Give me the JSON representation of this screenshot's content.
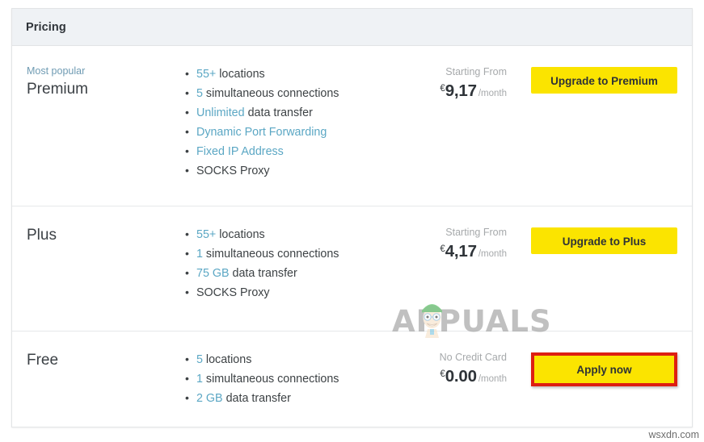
{
  "card": {
    "header_title": "Pricing"
  },
  "plans": [
    {
      "badge": "Most popular",
      "name": "Premium",
      "features": [
        {
          "highlight": "55+",
          "rest": " locations"
        },
        {
          "highlight": "5",
          "rest": " simultaneous connections"
        },
        {
          "highlight": "Unlimited",
          "rest": " data transfer"
        },
        {
          "highlight": "Dynamic Port Forwarding",
          "rest": ""
        },
        {
          "highlight": "Fixed IP Address",
          "rest": ""
        },
        {
          "highlight": "",
          "rest": "SOCKS Proxy"
        }
      ],
      "price_caption": "Starting From",
      "currency": "€",
      "price": "9,17",
      "period": "/month",
      "button_label": "Upgrade to Premium",
      "button_highlighted": false
    },
    {
      "badge": "",
      "name": "Plus",
      "features": [
        {
          "highlight": "55+",
          "rest": " locations"
        },
        {
          "highlight": "1",
          "rest": " simultaneous connections"
        },
        {
          "highlight": "75 GB",
          "rest": " data transfer"
        },
        {
          "highlight": "",
          "rest": "SOCKS Proxy"
        }
      ],
      "price_caption": "Starting From",
      "currency": "€",
      "price": "4,17",
      "period": "/month",
      "button_label": "Upgrade to Plus",
      "button_highlighted": false
    },
    {
      "badge": "",
      "name": "Free",
      "features": [
        {
          "highlight": "5",
          "rest": " locations"
        },
        {
          "highlight": "1",
          "rest": " simultaneous connections"
        },
        {
          "highlight": "2 GB",
          "rest": " data transfer"
        }
      ],
      "price_caption": "No Credit Card",
      "currency": "€",
      "price": "0.00",
      "period": "/month",
      "button_label": "Apply now",
      "button_highlighted": true
    }
  ],
  "watermark": {
    "text": "APPUALS"
  },
  "site_tag": "wsxdn.com",
  "colors": {
    "button_yellow": "#fbe400",
    "highlight_red": "#dd1f12",
    "feature_link": "#5ba7c4",
    "header_bg": "#eff2f5",
    "badge": "#6f9bb3"
  }
}
